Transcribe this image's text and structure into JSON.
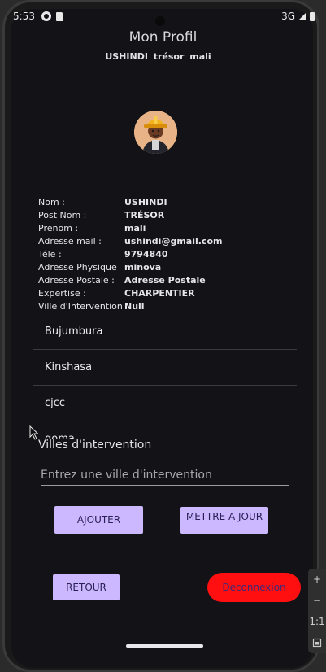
{
  "status": {
    "time": "5:53",
    "network": "3G"
  },
  "header": {
    "title": "Mon Profil",
    "subtitle": "USHINDI trésor mali"
  },
  "profile": {
    "rows": [
      {
        "label": "Nom :",
        "value": "USHINDI"
      },
      {
        "label": "Post Nom :",
        "value": "TRÉSOR"
      },
      {
        "label": "Prenom :",
        "value": "mali"
      },
      {
        "label": "Adresse mail :",
        "value": "ushindi@gmail.com"
      },
      {
        "label": "Téle :",
        "value": "9794840"
      },
      {
        "label": "Adresse Physique",
        "value": "minova"
      },
      {
        "label": "Adresse Postale :",
        "value": "Adresse Postale"
      },
      {
        "label": "Expertise :",
        "value": "CHARPENTIER"
      },
      {
        "label": "Ville d'Intervention",
        "value": "Null"
      }
    ]
  },
  "cities": {
    "items": [
      "Bujumbura",
      "Kinshasa",
      "cjcc",
      "goma"
    ]
  },
  "intervention": {
    "section_title": "Villes d'intervention",
    "placeholder": "Entrez une ville d'intervention"
  },
  "buttons": {
    "add": "AJOUTER",
    "update": "METTRE A JOUR",
    "back": "RETOUR",
    "logout": "Deconnexion"
  },
  "zoom_panel": {
    "plus": "+",
    "minus": "−",
    "ratio": "1:1"
  },
  "colors": {
    "accent": "#cbb8ff",
    "logout": "#ff0f10",
    "background": "#131317"
  }
}
